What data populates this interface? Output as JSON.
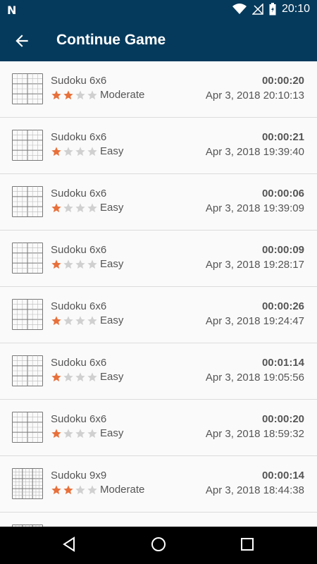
{
  "status_bar": {
    "time": "20:10",
    "left_icon": "n-notification-icon"
  },
  "app_bar": {
    "title": "Continue Game",
    "back_icon": "arrow-back-icon"
  },
  "colors": {
    "primary": "#063a5c",
    "star_filled": "#e8703a",
    "star_empty": "#d0d0d0"
  },
  "games": [
    {
      "name": "Sudoku 6x6",
      "grid": 6,
      "stars": 2,
      "difficulty": "Moderate",
      "time": "00:00:20",
      "date": "Apr 3, 2018 20:10:13"
    },
    {
      "name": "Sudoku 6x6",
      "grid": 6,
      "stars": 1,
      "difficulty": "Easy",
      "time": "00:00:21",
      "date": "Apr 3, 2018 19:39:40"
    },
    {
      "name": "Sudoku 6x6",
      "grid": 6,
      "stars": 1,
      "difficulty": "Easy",
      "time": "00:00:06",
      "date": "Apr 3, 2018 19:39:09"
    },
    {
      "name": "Sudoku 6x6",
      "grid": 6,
      "stars": 1,
      "difficulty": "Easy",
      "time": "00:00:09",
      "date": "Apr 3, 2018 19:28:17"
    },
    {
      "name": "Sudoku 6x6",
      "grid": 6,
      "stars": 1,
      "difficulty": "Easy",
      "time": "00:00:26",
      "date": "Apr 3, 2018 19:24:47"
    },
    {
      "name": "Sudoku 6x6",
      "grid": 6,
      "stars": 1,
      "difficulty": "Easy",
      "time": "00:01:14",
      "date": "Apr 3, 2018 19:05:56"
    },
    {
      "name": "Sudoku 6x6",
      "grid": 6,
      "stars": 1,
      "difficulty": "Easy",
      "time": "00:00:20",
      "date": "Apr 3, 2018 18:59:32"
    },
    {
      "name": "Sudoku 9x9",
      "grid": 9,
      "stars": 2,
      "difficulty": "Moderate",
      "time": "00:00:14",
      "date": "Apr 3, 2018 18:44:38"
    }
  ],
  "nav_bar": {
    "back": "nav-back-icon",
    "home": "nav-home-icon",
    "recents": "nav-recents-icon"
  }
}
